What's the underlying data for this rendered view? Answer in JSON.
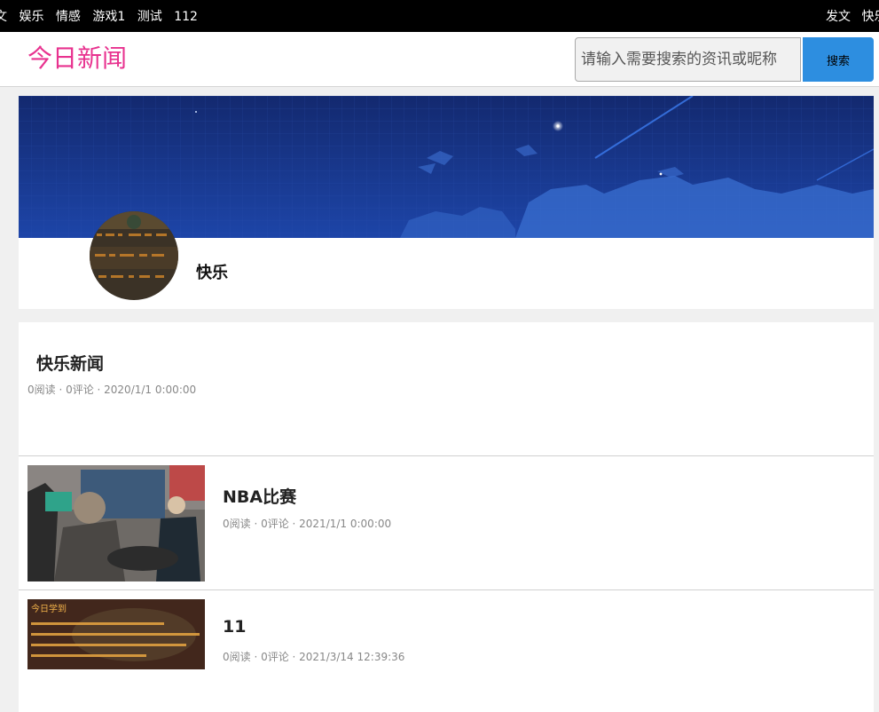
{
  "topbar": {
    "left_items": [
      "文",
      "娱乐",
      "情感",
      "游戏1",
      "测试",
      "112"
    ],
    "right_items": [
      "发文",
      "快乐"
    ]
  },
  "header": {
    "logo": "今日新闻",
    "search_placeholder": "请输入需要搜索的资讯或昵称",
    "search_button": "搜索"
  },
  "profile": {
    "name": "快乐"
  },
  "articles": [
    {
      "title": "快乐新闻",
      "reads": "0阅读",
      "comments": "0评论",
      "date": "2020/1/1 0:00:00",
      "meta": "0阅读 · 0评论 · 2020/1/1 0:00:00"
    },
    {
      "title": "NBA比赛",
      "reads": "0阅读",
      "comments": "0评论",
      "date": "2021/1/1 0:00:00",
      "meta": "0阅读 · 0评论 · 2021/1/1 0:00:00"
    },
    {
      "title": "11",
      "reads": "0阅读",
      "comments": "0评论",
      "date": "2021/3/14 12:39:36",
      "meta": "0阅读 · 0评论 · 2021/3/14 12:39:36"
    }
  ],
  "thumb_texts": {
    "article3_heading": "今日学到"
  },
  "colors": {
    "logo": "#e8328f",
    "search_button": "#2d8ee0",
    "topbar": "#000000",
    "banner": "#1a3a8c"
  }
}
